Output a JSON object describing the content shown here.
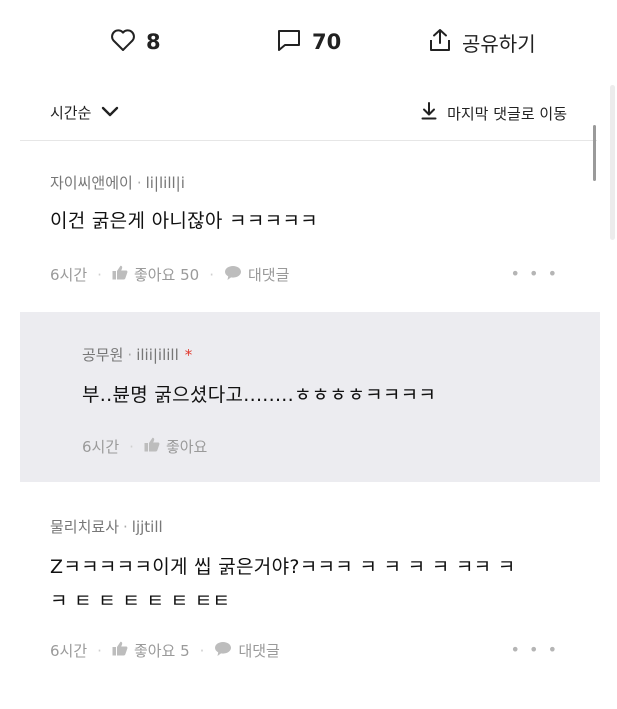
{
  "stats": {
    "likes": "8",
    "comments": "70",
    "share_label": "공유하기"
  },
  "sort": {
    "label": "시간순",
    "jump_label": "마지막 댓글로 이동"
  },
  "comments": [
    {
      "author": "자이씨앤에이",
      "handle": "li|lill|i",
      "text": "이건 굵은게 아니잖아 ㅋㅋㅋㅋㅋ",
      "time": "6시간",
      "like_label": "좋아요 50",
      "reply_label": "대댓글"
    },
    {
      "author": "공무원",
      "handle": "ilii|ilill",
      "star": "*",
      "text": "부..뷴명 굵으셨다고........ㅎㅎㅎㅎㅋㅋㅋㅋ",
      "time": "6시간",
      "like_label": "좋아요"
    },
    {
      "author": "물리치료사",
      "handle": "ljjtill",
      "text_line1": "Zㅋㅋㅋㅋㅋ이게 씹 굵은거야?ㅋㅋㅋ ㅋ ㅋ ㅋ ㅋ ㅋㅋ ㅋ",
      "text_line2": "ㅋ ㅌ ㅌ ㅌ ㅌ ㅌ ㅌㅌ",
      "time": "6시간",
      "like_label": "좋아요 5",
      "reply_label": "대댓글"
    }
  ],
  "more_label": "• • •",
  "separator": "·"
}
